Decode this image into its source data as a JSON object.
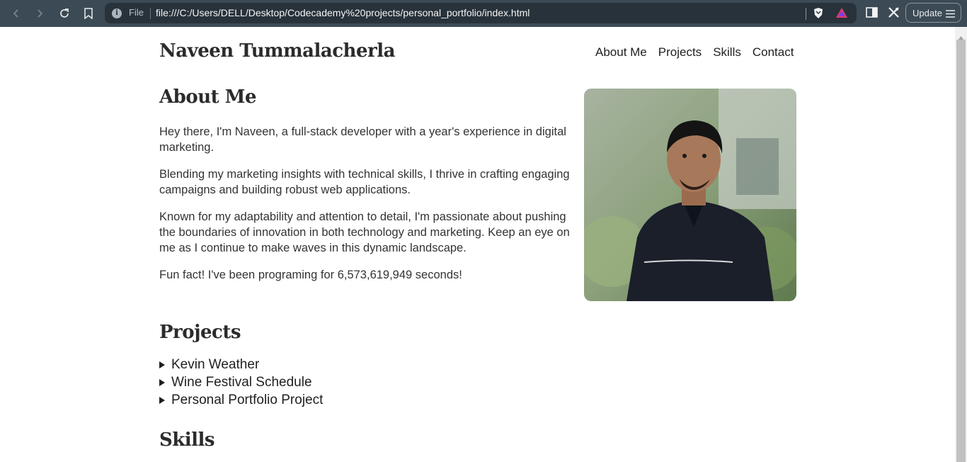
{
  "browser": {
    "file_label": "File",
    "url": "file:///C:/Users/DELL/Desktop/Codecademy%20projects/personal_portfolio/index.html",
    "update_label": "Update",
    "icons": [
      "back-icon",
      "forward-icon",
      "reload-icon",
      "bookmark-icon",
      "info-icon",
      "brave-shield-icon",
      "brave-rewards-icon",
      "sidebar-icon",
      "leo-icon",
      "menu-icon"
    ]
  },
  "header": {
    "title": "Naveen Tummalacherla",
    "nav": [
      "About Me",
      "Projects",
      "Skills",
      "Contact"
    ]
  },
  "about": {
    "heading": "About Me",
    "paragraphs": [
      "Hey there, I'm Naveen, a full-stack developer with a year's experience in digital marketing.",
      "Blending my marketing insights with technical skills, I thrive in crafting engaging campaigns and building robust web applications.",
      "Known for my adaptability and attention to detail, I'm passionate about pushing the boundaries of innovation in both technology and marketing. Keep an eye on me as I continue to make waves in this dynamic landscape.",
      "Fun fact! I've been programing for 6,573,619,949 seconds!"
    ]
  },
  "projects": {
    "heading": "Projects",
    "items": [
      "Kevin Weather",
      "Wine Festival Schedule",
      "Personal Portfolio Project"
    ]
  },
  "skills": {
    "heading": "Skills"
  },
  "colors": {
    "toolbar": "#3c4a55",
    "urlbar": "#28323a",
    "text": "#2b2b2b"
  }
}
